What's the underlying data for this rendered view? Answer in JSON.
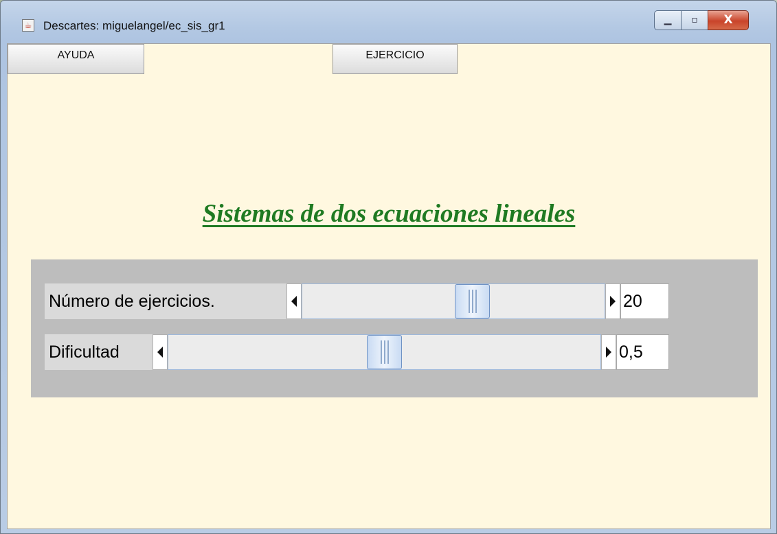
{
  "window": {
    "title": "Descartes: miguelangel/ec_sis_gr1",
    "minimize_glyph": "▁",
    "maximize_glyph": "▫",
    "close_glyph": "X"
  },
  "tabs": {
    "help_label": "AYUDA",
    "exercise_label": "EJERCICIO"
  },
  "heading": "Sistemas de dos ecuaciones lineales",
  "controls": {
    "exercises": {
      "label": "Número de ejercicios.",
      "value": "20",
      "slider_fraction": 0.57
    },
    "difficulty": {
      "label": "Dificultad",
      "value": "0,5",
      "slider_fraction": 0.5
    }
  },
  "colors": {
    "heading": "#1f7a22",
    "background": "#fff8e0",
    "panel": "#bdbdbd"
  },
  "icons": {
    "app": "java-coffee-icon"
  }
}
